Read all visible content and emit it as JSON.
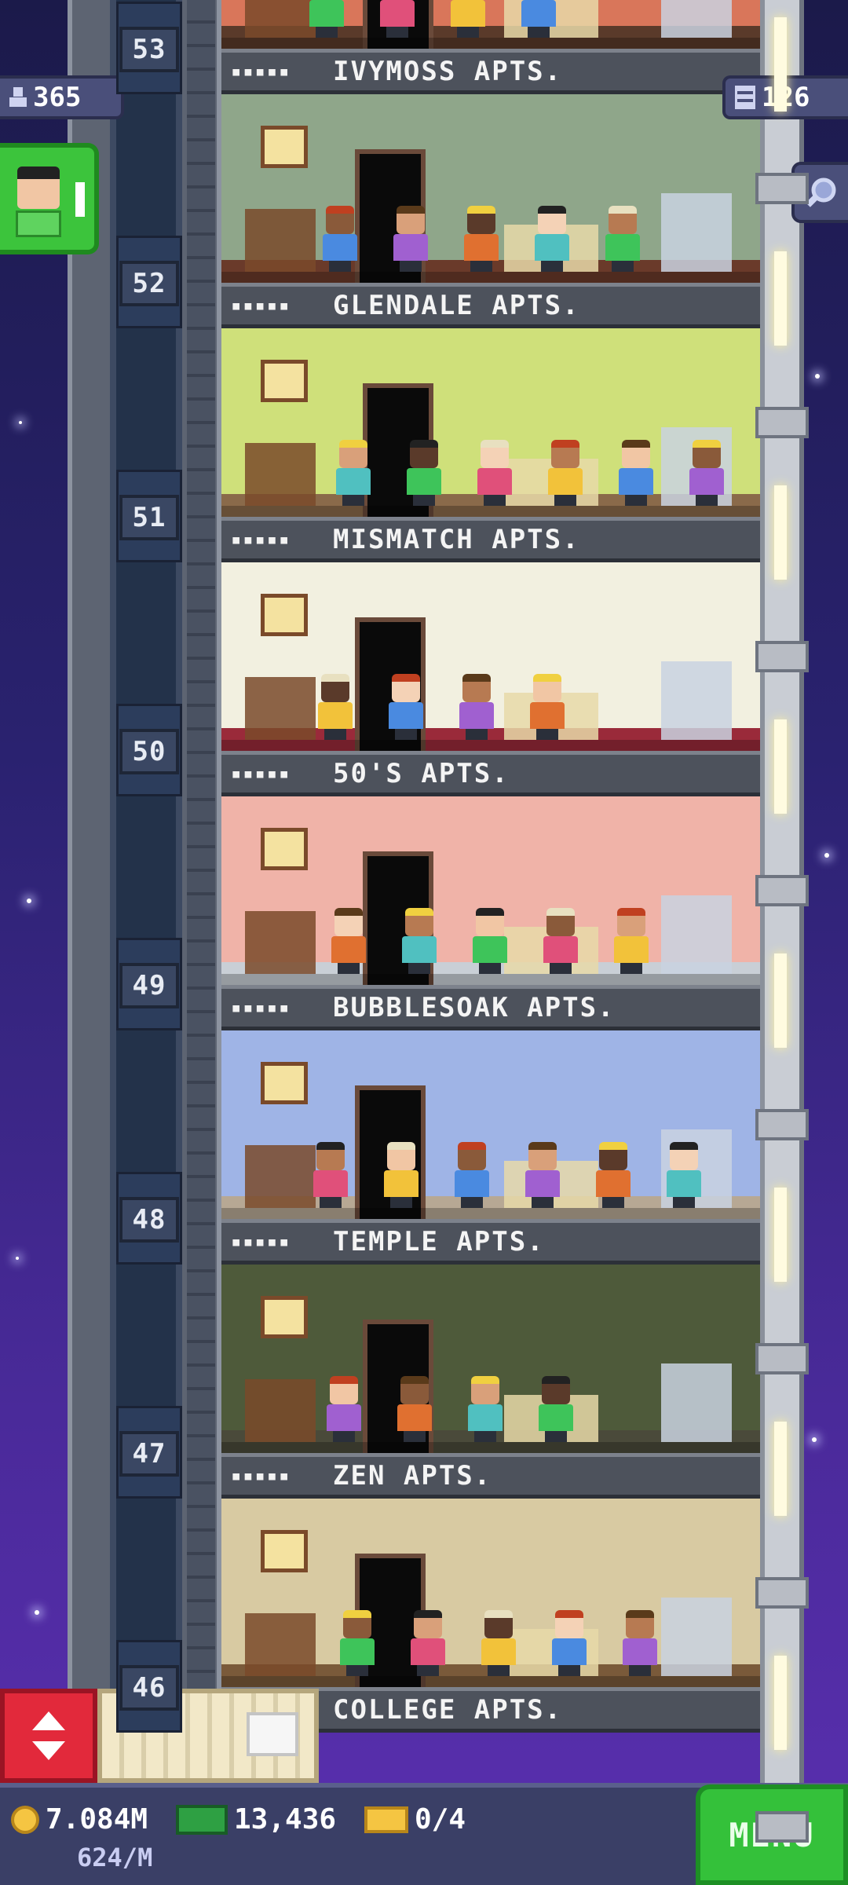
{
  "hud": {
    "population": "365",
    "floor_count": "126"
  },
  "floors": [
    {
      "number": "53",
      "name": "IVYMOSS APTS.",
      "stars": "▪▪▪▪▪",
      "wall": "#d9765a",
      "floor_color": "#5a3a2a"
    },
    {
      "number": "52",
      "name": "GLENDALE APTS.",
      "stars": "▪▪▪▪▪",
      "wall": "#8fa68a",
      "floor_color": "#6a3a2a"
    },
    {
      "number": "51",
      "name": "MISMATCH APTS.",
      "stars": "▪▪▪▪▪",
      "wall": "#cfe07a",
      "floor_color": "#8a6a4a"
    },
    {
      "number": "50",
      "name": "50'S APTS.",
      "stars": "▪▪▪▪▪",
      "wall": "#f2f0e0",
      "floor_color": "#9a2a3a"
    },
    {
      "number": "49",
      "name": "BUBBLESOAK APTS.",
      "stars": "▪▪▪▪▪",
      "wall": "#f0b3a8",
      "floor_color": "#c9cfd6"
    },
    {
      "number": "48",
      "name": "TEMPLE APTS.",
      "stars": "▪▪▪▪▪",
      "wall": "#9fb4e6",
      "floor_color": "#b7a894"
    },
    {
      "number": "47",
      "name": "ZEN APTS.",
      "stars": "▪▪▪▪▪",
      "wall": "#4e5a3a",
      "floor_color": "#4a4a3a"
    },
    {
      "number": "46",
      "name": "COLLEGE APTS.",
      "stars": "▪▪▪▪▪",
      "wall": "#d8caa2",
      "floor_color": "#7a5a3a"
    }
  ],
  "bottom": {
    "coins": "7.084M",
    "income": "624/M",
    "bux": "13,436",
    "tickets": "0/4",
    "menu_label": "MENU"
  },
  "icons": {
    "population": "person-icon",
    "floors": "building-grid-icon",
    "search": "magnifier-icon",
    "elevator": "up-down-arrows-icon"
  }
}
